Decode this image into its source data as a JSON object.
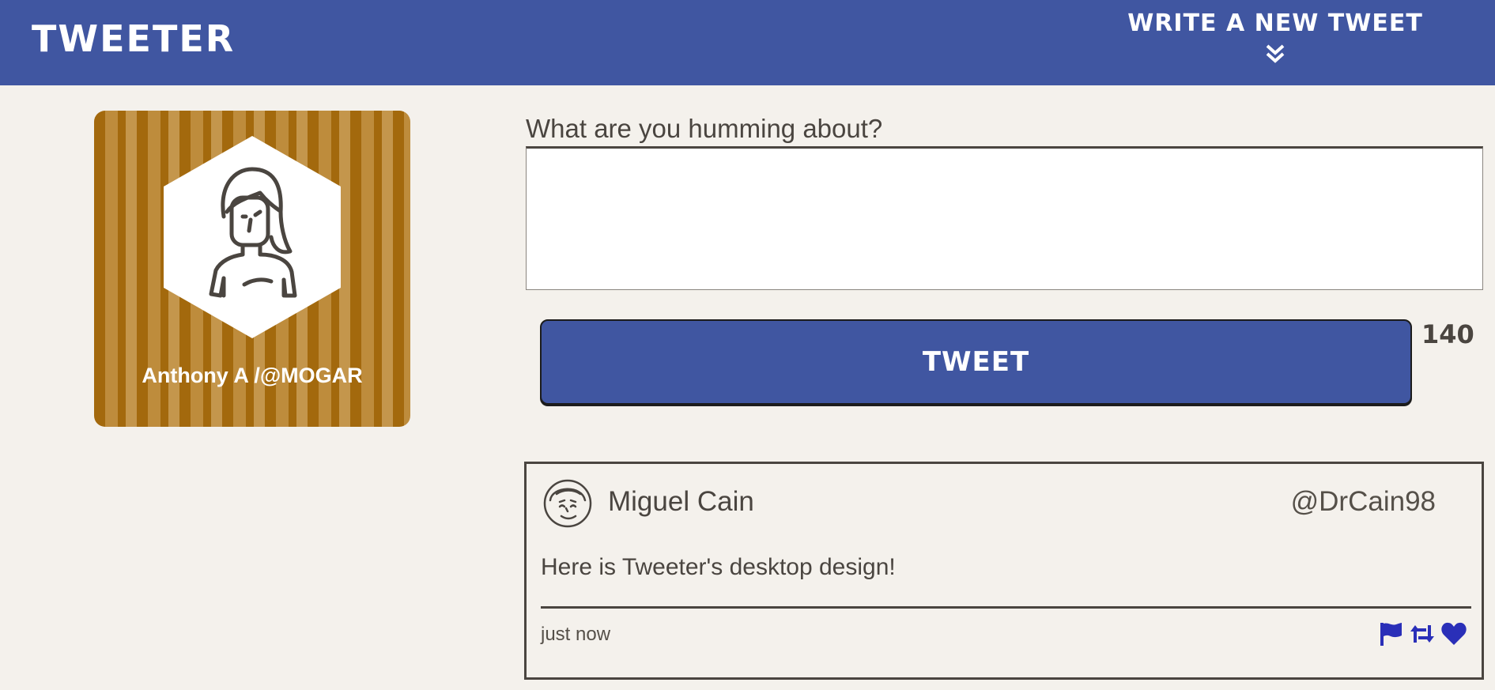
{
  "nav": {
    "brand": "TWEETER",
    "compose_label": "WRITE A NEW TWEET",
    "compose_icon": "double-chevron-down-icon"
  },
  "profile": {
    "name": "Anthony A /@MOGAR",
    "avatar_icon": "woman-avatar-icon"
  },
  "composer": {
    "prompt": "What are you humming about?",
    "value": "",
    "button_label": "TWEET",
    "counter": "140"
  },
  "tweets": [
    {
      "avatar_icon": "man-avatar-icon",
      "name": "Miguel Cain",
      "handle": "@DrCain98",
      "content": "Here is Tweeter's desktop design!",
      "time": "just now",
      "actions": [
        "flag-icon",
        "retweet-icon",
        "heart-icon"
      ]
    }
  ],
  "colors": {
    "nav_bg": "#4056a1",
    "page_bg": "#f4f1ec",
    "text": "#4a4540",
    "action_icon": "#2a2fb8",
    "profile_bg": "#a3690d"
  }
}
